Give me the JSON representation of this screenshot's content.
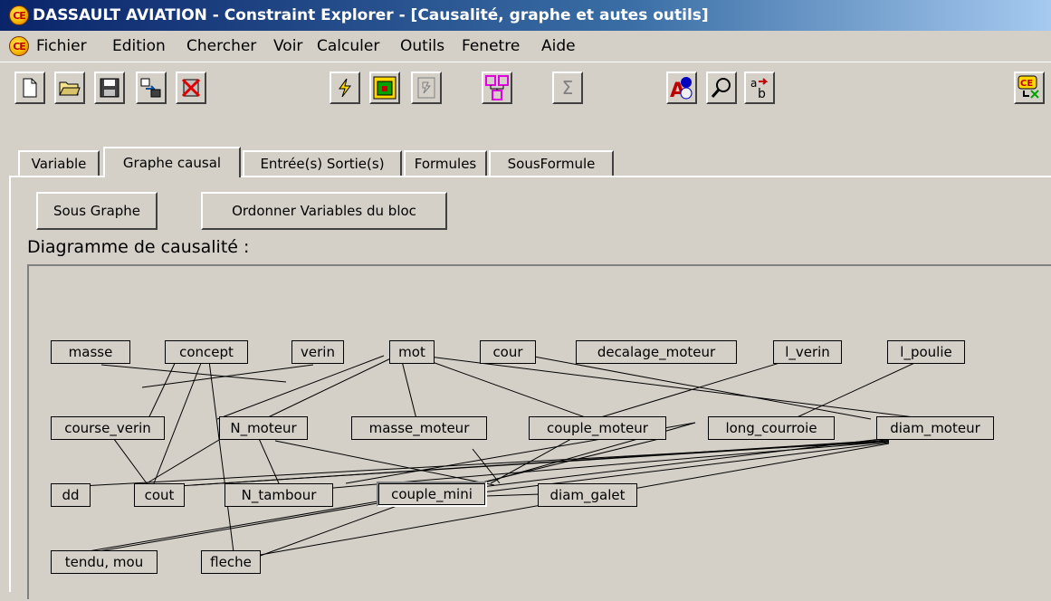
{
  "window": {
    "title": "DASSAULT AVIATION - Constraint Explorer  - [Causalité, graphe et autes outils]",
    "logo_text": "CE"
  },
  "menu": [
    "Fichier",
    "Edition",
    "Chercher",
    "Voir",
    "Calculer",
    "Outils",
    "Fenetre",
    "Aide"
  ],
  "toolbar": {
    "buttons": [
      "new-file-icon",
      "open-folder-icon",
      "save-disk-icon",
      "export-icon",
      "delete-red-x-icon",
      "lightning-icon",
      "stop-green-icon",
      "sort-icon",
      "graph-tree-icon",
      "sigma-icon",
      "spellcheck-icon",
      "search-magnifier-icon",
      "replace-ab-icon",
      "ce-exit-icon"
    ],
    "sigma_glyph": "Σ",
    "replace_a": "a",
    "replace_b": "b"
  },
  "tabs": [
    "Variable",
    "Graphe causal",
    "Entrée(s) Sortie(s)",
    "Formules",
    "SousFormule"
  ],
  "active_tab": "Graphe causal",
  "panel": {
    "sous_graphe_button": "Sous Graphe",
    "ordonner_button": "Ordonner Variables du bloc",
    "diagram_label": "Diagramme de causalité :"
  },
  "diagram": {
    "nodes": [
      "masse",
      "concept",
      "verin",
      "mot",
      "cour",
      "decalage_moteur",
      "l_verin",
      "l_poulie",
      "course_verin",
      "N_moteur",
      "masse_moteur",
      "couple_moteur",
      "long_courroie",
      "diam_moteur",
      "dd",
      "cout",
      "N_tambour",
      "couple_mini",
      "diam_galet",
      "tendu, mou",
      "fleche"
    ]
  }
}
